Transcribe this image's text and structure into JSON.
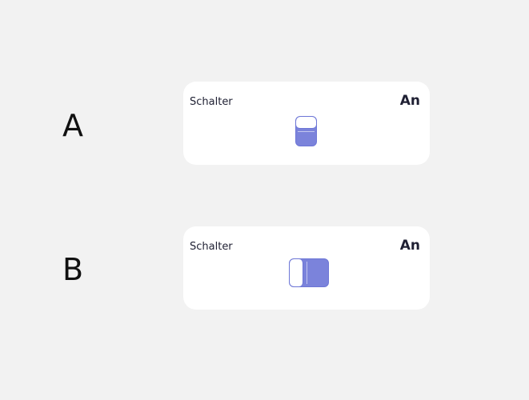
{
  "options": [
    {
      "letter": "A",
      "card": {
        "label": "Schalter",
        "state": "An",
        "toggle": {
          "orientation": "vertical",
          "on": true
        }
      }
    },
    {
      "letter": "B",
      "card": {
        "label": "Schalter",
        "state": "An",
        "toggle": {
          "orientation": "horizontal",
          "on": true
        }
      }
    }
  ],
  "colors": {
    "background": "#f2f2f2",
    "card": "#ffffff",
    "toggle_fill": "#7b83db",
    "toggle_border": "#6d76d6",
    "text": "#1f2033"
  }
}
